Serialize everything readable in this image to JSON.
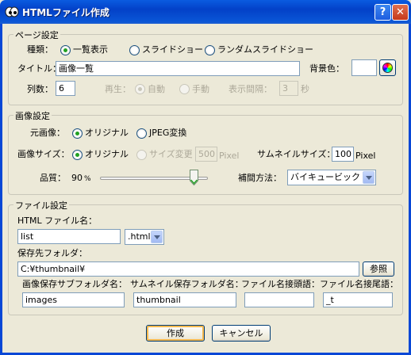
{
  "window": {
    "title": "HTMLファイル作成",
    "help_glyph": "?",
    "close_glyph": "✕"
  },
  "page_settings": {
    "legend": "ページ設定",
    "kind_label": "種類：",
    "kind_options": [
      "一覧表示",
      "スライドショー",
      "ランダムスライドショー"
    ],
    "kind_selected": "一覧表示",
    "title_label": "タイトル：",
    "title_value": "画像一覧",
    "bgcolor_label": "背景色：",
    "bgcolor_value": "#ffffff",
    "columns_label": "列数：",
    "columns_value": "6",
    "play_label": "再生：",
    "play_options": [
      "自動",
      "手動"
    ],
    "interval_label": "表示間隔：",
    "interval_value": "3",
    "interval_unit": "秒"
  },
  "image_settings": {
    "legend": "画像設定",
    "source_label": "元画像：",
    "source_options": [
      "オリジナル",
      "JPEG変換"
    ],
    "size_label": "画像サイズ：",
    "size_options": [
      "オリジナル",
      "サイズ変更"
    ],
    "size_value": "500",
    "size_unit": "Pixel",
    "thumb_size_label": "サムネイルサイズ：",
    "thumb_size_value": "100",
    "thumb_size_unit": "Pixel",
    "quality_label": "品質：",
    "quality_value": "90",
    "quality_unit": "%",
    "quality_level": 90,
    "interp_label": "補間方法：",
    "interp_value": "バイキュービック"
  },
  "file_settings": {
    "legend": "ファイル設定",
    "html_name_label": "HTML ファイル名：",
    "html_name_value": "list",
    "ext_value": ".html",
    "dest_label": "保存先フォルダ：",
    "dest_value": "C:¥thumbnail¥",
    "browse_label": "参照",
    "img_sub_label": "画像保存サブフォルダ名：",
    "img_sub_value": "images",
    "thumb_sub_label": "サムネイル保存フォルダ名：",
    "thumb_sub_value": "thumbnail",
    "prefix_label": "ファイル名接頭語：",
    "prefix_value": "",
    "suffix_label": "ファイル名接尾語：",
    "suffix_value": "_t"
  },
  "buttons": {
    "create": "作成",
    "cancel": "キャンセル"
  }
}
